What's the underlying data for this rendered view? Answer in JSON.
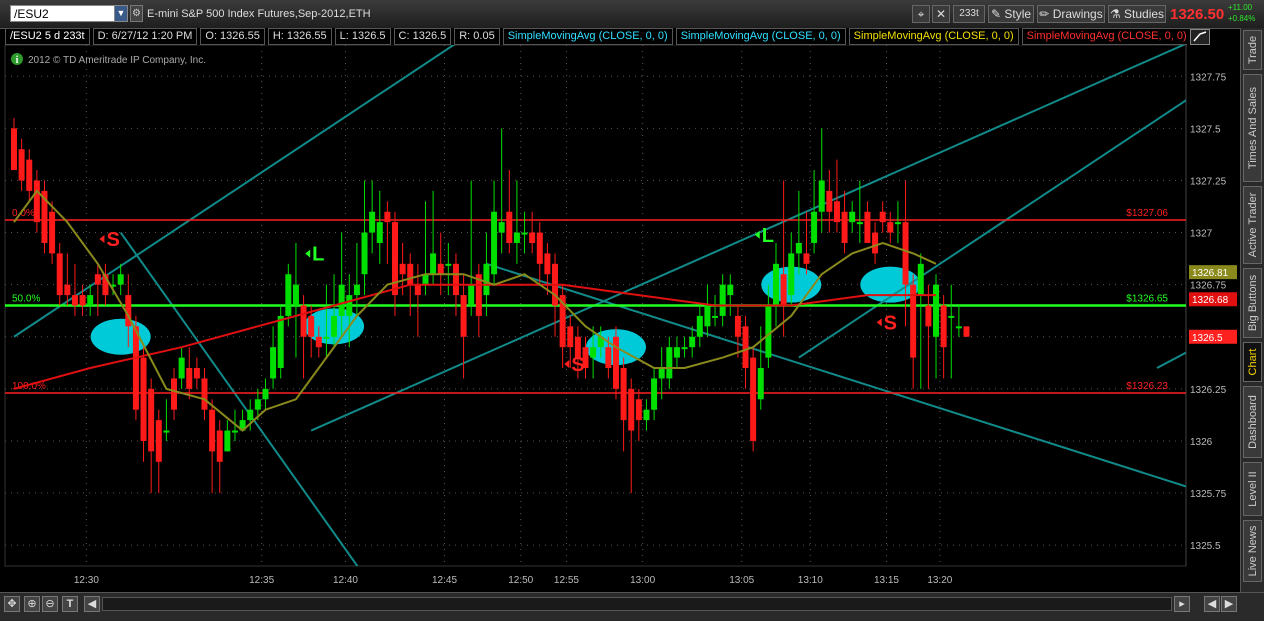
{
  "header": {
    "symbol": "/ESU2",
    "title": "E-mini S&P 500 Index Futures,Sep-2012,ETH",
    "aggregation": "233t",
    "style_label": "Style",
    "drawings_label": "Drawings",
    "studies_label": "Studies",
    "last_price": "1326.50",
    "change": "+11.00",
    "change_pct": "+0.84%"
  },
  "infobar": {
    "symbol_period": "/ESU2 5 d 233t",
    "date": "D: 6/27/12 1:20 PM",
    "open": "O: 1326.55",
    "high": "H: 1326.55",
    "low": "L: 1326.5",
    "close": "C: 1326.5",
    "range": "R: 0.05",
    "studies": [
      {
        "label": "SimpleMovingAvg (CLOSE, 0, 0)",
        "color": "#30e0ff"
      },
      {
        "label": "SimpleMovingAvg (CLOSE, 0, 0)",
        "color": "#30e0ff"
      },
      {
        "label": "SimpleMovingAvg (CLOSE, 0, 0)",
        "color": "#f0e000"
      },
      {
        "label": "SimpleMovingAvg (CLOSE, 0, 0)",
        "color": "#ff3030"
      },
      {
        "label": "SimpleMovingAvg...",
        "color": "#888888"
      }
    ]
  },
  "copyright": "2012 © TD Ameritrade IP Company, Inc.",
  "sidebar": [
    "Trade",
    "Times And Sales",
    "Active Trader",
    "Big Buttons",
    "Chart",
    "Dashboard",
    "Level II",
    "Live News"
  ],
  "colors": {
    "up": "#00e000",
    "down": "#ff1a1a",
    "channel": "#118a8a",
    "fib": "#ff2020",
    "mid": "#22ff22",
    "sma_fast": "#8a8a1c",
    "sma_slow": "#e01010",
    "highlight": "#00e0f0"
  },
  "chart_data": {
    "type": "candlestick",
    "y_range": [
      1325.4,
      1327.9
    ],
    "y_ticks": [
      "1325.5",
      "1325.75",
      "1326",
      "1326.25",
      "1326.5",
      "1326.75",
      "1327",
      "1327.25",
      "1327.5",
      "1327.75"
    ],
    "x_ticks": [
      {
        "label": "12:30",
        "bar": 9.5
      },
      {
        "label": "12:35",
        "bar": 32.5
      },
      {
        "label": "12:40",
        "bar": 43.5
      },
      {
        "label": "12:45",
        "bar": 56.5
      },
      {
        "label": "12:50",
        "bar": 66.5
      },
      {
        "label": "12:55",
        "bar": 72.5
      },
      {
        "label": "13:00",
        "bar": 82.5
      },
      {
        "label": "13:05",
        "bar": 95.5
      },
      {
        "label": "13:10",
        "bar": 104.5
      },
      {
        "label": "13:15",
        "bar": 114.5
      },
      {
        "label": "13:20",
        "bar": 121.5
      }
    ],
    "candles": [
      [
        1327.5,
        1327.3,
        1327.55,
        1327.3
      ],
      [
        1327.4,
        1327.25,
        1327.45,
        1327.2
      ],
      [
        1327.35,
        1327.2,
        1327.4,
        1327.15
      ],
      [
        1327.25,
        1327.05,
        1327.3,
        1327.0
      ],
      [
        1327.2,
        1326.95,
        1327.25,
        1326.9
      ],
      [
        1327.1,
        1326.9,
        1327.15,
        1326.85
      ],
      [
        1326.9,
        1326.7,
        1326.95,
        1326.65
      ],
      [
        1326.75,
        1326.7,
        1326.9,
        1326.65
      ],
      [
        1326.7,
        1326.65,
        1326.85,
        1326.6
      ],
      [
        1326.7,
        1326.65,
        1326.75,
        1326.6
      ],
      [
        1326.65,
        1326.7,
        1326.75,
        1326.6
      ],
      [
        1326.8,
        1326.75,
        1326.85,
        1326.6
      ],
      [
        1326.8,
        1326.7,
        1326.85,
        1326.65
      ],
      [
        1326.75,
        1326.75,
        1326.8,
        1326.7
      ],
      [
        1326.75,
        1326.8,
        1326.85,
        1326.7
      ],
      [
        1326.7,
        1326.55,
        1326.8,
        1326.45
      ],
      [
        1326.55,
        1326.15,
        1326.6,
        1326.1
      ],
      [
        1326.4,
        1326.0,
        1326.45,
        1325.9
      ],
      [
        1326.25,
        1325.95,
        1326.3,
        1325.75
      ],
      [
        1326.1,
        1325.9,
        1326.15,
        1325.75
      ],
      [
        1326.05,
        1326.05,
        1326.2,
        1326.0
      ],
      [
        1326.3,
        1326.15,
        1326.35,
        1326.1
      ],
      [
        1326.3,
        1326.4,
        1326.45,
        1326.25
      ],
      [
        1326.35,
        1326.25,
        1326.45,
        1326.2
      ],
      [
        1326.35,
        1326.3,
        1326.4,
        1326.25
      ],
      [
        1326.3,
        1326.15,
        1326.35,
        1326.1
      ],
      [
        1326.15,
        1325.95,
        1326.2,
        1325.75
      ],
      [
        1326.05,
        1325.9,
        1326.1,
        1325.75
      ],
      [
        1325.95,
        1326.05,
        1326.1,
        1325.95
      ],
      [
        1326.05,
        1326.05,
        1326.15,
        1326.0
      ],
      [
        1326.05,
        1326.1,
        1326.15,
        1326.05
      ],
      [
        1326.1,
        1326.15,
        1326.2,
        1326.05
      ],
      [
        1326.15,
        1326.2,
        1326.25,
        1326.1
      ],
      [
        1326.2,
        1326.25,
        1326.3,
        1326.15
      ],
      [
        1326.3,
        1326.45,
        1326.55,
        1326.25
      ],
      [
        1326.35,
        1326.6,
        1326.65,
        1326.3
      ],
      [
        1326.6,
        1326.8,
        1326.85,
        1326.55
      ],
      [
        1326.65,
        1326.75,
        1326.95,
        1326.4
      ],
      [
        1326.65,
        1326.5,
        1326.7,
        1326.3
      ],
      [
        1326.6,
        1326.5,
        1326.65,
        1326.4
      ],
      [
        1326.5,
        1326.45,
        1326.55,
        1326.4
      ],
      [
        1326.5,
        1326.5,
        1326.75,
        1326.4
      ],
      [
        1326.5,
        1326.6,
        1326.8,
        1326.45
      ],
      [
        1326.6,
        1326.75,
        1327.0,
        1326.5
      ],
      [
        1326.6,
        1326.7,
        1326.8,
        1326.45
      ],
      [
        1326.7,
        1326.75,
        1326.95,
        1326.6
      ],
      [
        1326.8,
        1327.0,
        1327.25,
        1326.7
      ],
      [
        1327.0,
        1327.1,
        1327.25,
        1326.9
      ],
      [
        1326.95,
        1327.05,
        1327.2,
        1326.85
      ],
      [
        1327.1,
        1327.05,
        1327.15,
        1326.85
      ],
      [
        1327.05,
        1326.7,
        1327.1,
        1326.6
      ],
      [
        1326.85,
        1326.8,
        1326.95,
        1326.7
      ],
      [
        1326.85,
        1326.75,
        1326.9,
        1326.6
      ],
      [
        1326.75,
        1326.7,
        1326.85,
        1326.5
      ],
      [
        1326.75,
        1326.8,
        1327.15,
        1326.7
      ],
      [
        1326.8,
        1326.9,
        1327.2,
        1326.75
      ],
      [
        1326.85,
        1326.8,
        1327.0,
        1326.7
      ],
      [
        1326.85,
        1326.85,
        1326.95,
        1326.7
      ],
      [
        1326.85,
        1326.7,
        1326.9,
        1326.6
      ],
      [
        1326.7,
        1326.5,
        1326.8,
        1326.3
      ],
      [
        1326.65,
        1326.75,
        1327.25,
        1326.6
      ],
      [
        1326.8,
        1326.6,
        1326.85,
        1326.5
      ],
      [
        1326.7,
        1326.85,
        1327.0,
        1326.6
      ],
      [
        1326.8,
        1327.1,
        1327.25,
        1326.75
      ],
      [
        1327.0,
        1327.05,
        1327.5,
        1326.9
      ],
      [
        1327.1,
        1326.95,
        1327.3,
        1326.9
      ],
      [
        1326.95,
        1327.0,
        1327.25,
        1326.85
      ],
      [
        1327.0,
        1327.0,
        1327.1,
        1326.9
      ],
      [
        1327.0,
        1326.95,
        1327.1,
        1326.9
      ],
      [
        1327.0,
        1326.85,
        1327.05,
        1326.75
      ],
      [
        1326.9,
        1326.8,
        1326.95,
        1326.7
      ],
      [
        1326.85,
        1326.65,
        1326.9,
        1326.5
      ],
      [
        1326.7,
        1326.45,
        1326.75,
        1326.35
      ],
      [
        1326.55,
        1326.45,
        1326.6,
        1326.35
      ],
      [
        1326.5,
        1326.4,
        1326.55,
        1326.3
      ],
      [
        1326.45,
        1326.35,
        1326.5,
        1326.3
      ],
      [
        1326.4,
        1326.45,
        1326.55,
        1326.3
      ],
      [
        1326.45,
        1326.5,
        1326.55,
        1326.4
      ],
      [
        1326.45,
        1326.35,
        1326.5,
        1326.3
      ],
      [
        1326.5,
        1326.25,
        1326.55,
        1326.2
      ],
      [
        1326.35,
        1326.1,
        1326.4,
        1325.95
      ],
      [
        1326.25,
        1326.05,
        1326.3,
        1325.75
      ],
      [
        1326.2,
        1326.1,
        1326.25,
        1326.0
      ],
      [
        1326.1,
        1326.15,
        1326.2,
        1326.05
      ],
      [
        1326.15,
        1326.3,
        1326.35,
        1326.1
      ],
      [
        1326.3,
        1326.35,
        1326.45,
        1326.2
      ],
      [
        1326.3,
        1326.45,
        1326.5,
        1326.25
      ],
      [
        1326.4,
        1326.45,
        1326.5,
        1326.35
      ],
      [
        1326.45,
        1326.45,
        1326.5,
        1326.4
      ],
      [
        1326.45,
        1326.5,
        1326.55,
        1326.4
      ],
      [
        1326.5,
        1326.6,
        1326.65,
        1326.45
      ],
      [
        1326.55,
        1326.65,
        1326.75,
        1326.5
      ],
      [
        1326.6,
        1326.6,
        1326.7,
        1326.55
      ],
      [
        1326.6,
        1326.75,
        1326.8,
        1326.55
      ],
      [
        1326.7,
        1326.75,
        1326.8,
        1326.6
      ],
      [
        1326.6,
        1326.5,
        1326.65,
        1326.4
      ],
      [
        1326.55,
        1326.35,
        1326.6,
        1326.25
      ],
      [
        1326.4,
        1326.0,
        1326.45,
        1325.95
      ],
      [
        1326.2,
        1326.35,
        1326.55,
        1326.15
      ],
      [
        1326.4,
        1326.65,
        1326.75,
        1326.35
      ],
      [
        1326.65,
        1326.85,
        1326.95,
        1326.55
      ],
      [
        1326.8,
        1326.65,
        1327.25,
        1326.5
      ],
      [
        1326.7,
        1326.9,
        1327.0,
        1326.65
      ],
      [
        1326.9,
        1326.95,
        1327.2,
        1326.8
      ],
      [
        1326.9,
        1326.85,
        1327.1,
        1326.8
      ],
      [
        1326.95,
        1327.1,
        1327.3,
        1326.9
      ],
      [
        1327.1,
        1327.25,
        1327.5,
        1327.0
      ],
      [
        1327.2,
        1327.1,
        1327.3,
        1327.0
      ],
      [
        1327.15,
        1327.05,
        1327.35,
        1327.0
      ],
      [
        1327.1,
        1326.95,
        1327.2,
        1326.9
      ],
      [
        1327.05,
        1327.1,
        1327.15,
        1327.0
      ],
      [
        1327.05,
        1327.05,
        1327.25,
        1326.95
      ],
      [
        1327.1,
        1326.95,
        1327.15,
        1326.95
      ],
      [
        1327.0,
        1326.9,
        1327.05,
        1326.85
      ],
      [
        1327.1,
        1327.05,
        1327.15,
        1327.0
      ],
      [
        1327.05,
        1327.0,
        1327.1,
        1326.95
      ],
      [
        1327.05,
        1327.05,
        1327.15,
        1326.95
      ],
      [
        1327.05,
        1326.75,
        1327.25,
        1326.55
      ],
      [
        1326.75,
        1326.4,
        1326.8,
        1326.25
      ],
      [
        1326.7,
        1326.85,
        1326.9,
        1326.25
      ],
      [
        1326.65,
        1326.55,
        1326.75,
        1326.25
      ],
      [
        1326.5,
        1326.75,
        1326.8,
        1326.3
      ],
      [
        1326.65,
        1326.45,
        1326.7,
        1326.3
      ],
      [
        1326.6,
        1326.6,
        1326.75,
        1326.3
      ],
      [
        1326.55,
        1326.55,
        1326.65,
        1326.5
      ],
      [
        1326.55,
        1326.5,
        1326.55,
        1326.5
      ]
    ],
    "sma_fast": [
      [
        0,
        1327.05
      ],
      [
        3,
        1327.2
      ],
      [
        7,
        1327.05
      ],
      [
        11,
        1326.85
      ],
      [
        15,
        1326.6
      ],
      [
        20,
        1326.25
      ],
      [
        25,
        1326.2
      ],
      [
        30,
        1326.05
      ],
      [
        33,
        1326.15
      ],
      [
        37,
        1326.2
      ],
      [
        41,
        1326.4
      ],
      [
        45,
        1326.6
      ],
      [
        49,
        1326.75
      ],
      [
        54,
        1326.8
      ],
      [
        59,
        1326.8
      ],
      [
        63,
        1326.75
      ],
      [
        67,
        1326.8
      ],
      [
        71,
        1326.7
      ],
      [
        75,
        1326.55
      ],
      [
        79,
        1326.45
      ],
      [
        84,
        1326.35
      ],
      [
        88,
        1326.35
      ],
      [
        93,
        1326.4
      ],
      [
        97,
        1326.45
      ],
      [
        102,
        1326.6
      ],
      [
        106,
        1326.8
      ],
      [
        110,
        1326.9
      ],
      [
        114,
        1326.95
      ],
      [
        118,
        1326.9
      ],
      [
        121,
        1326.85
      ]
    ],
    "sma_slow": [
      [
        0,
        1326.25
      ],
      [
        10,
        1326.35
      ],
      [
        22,
        1326.45
      ],
      [
        32,
        1326.55
      ],
      [
        42,
        1326.65
      ],
      [
        52,
        1326.75
      ],
      [
        62,
        1326.75
      ],
      [
        72,
        1326.75
      ],
      [
        82,
        1326.7
      ],
      [
        92,
        1326.65
      ],
      [
        102,
        1326.65
      ],
      [
        112,
        1326.7
      ],
      [
        121,
        1326.7
      ]
    ],
    "channel_lines": [
      [
        [
          0,
          1326.5
        ],
        [
          103,
          1329.0
        ]
      ],
      [
        [
          103,
          1326.4
        ],
        [
          210,
          1329.0
        ]
      ],
      [
        [
          39,
          1326.05
        ],
        [
          172,
          1328.2
        ]
      ],
      [
        [
          150,
          1326.35
        ],
        [
          240,
          1328.1
        ]
      ],
      [
        [
          14,
          1327.0
        ],
        [
          47,
          1325.3
        ]
      ],
      [
        [
          62,
          1326.85
        ],
        [
          221,
          1325.0
        ]
      ]
    ],
    "fib_levels": [
      {
        "label": "0.0%",
        "value": 1327.06,
        "price_label": "$1327.06",
        "color": "#ff2020"
      },
      {
        "label": "50.0%",
        "value": 1326.65,
        "price_label": "$1326.65",
        "color": "#22ff22"
      },
      {
        "label": "100.0%",
        "value": 1326.23,
        "price_label": "$1326.23",
        "color": "#ff2020"
      }
    ],
    "price_markers": [
      {
        "value": 1326.81,
        "label": "1326.81",
        "bg": "#8a8a1c"
      },
      {
        "value": 1326.68,
        "label": "1326.68",
        "bg": "#e01010"
      },
      {
        "value": 1326.5,
        "label": "1326.5",
        "bg": "#ff2020"
      }
    ],
    "highlights": [
      {
        "bar": 14,
        "value": 1326.5
      },
      {
        "bar": 42,
        "value": 1326.55
      },
      {
        "bar": 79,
        "value": 1326.45
      },
      {
        "bar": 102,
        "value": 1326.75
      },
      {
        "bar": 115,
        "value": 1326.75
      }
    ],
    "signals": [
      {
        "type": "S",
        "bar": 12,
        "value": 1326.95,
        "color": "#ff2020"
      },
      {
        "type": "L",
        "bar": 39,
        "value": 1326.88,
        "color": "#22ff22"
      },
      {
        "type": "S",
        "bar": 73,
        "value": 1326.35,
        "color": "#ff2020"
      },
      {
        "type": "L",
        "bar": 98,
        "value": 1326.97,
        "color": "#22ff22"
      },
      {
        "type": "S",
        "bar": 114,
        "value": 1326.55,
        "color": "#ff2020"
      }
    ]
  }
}
